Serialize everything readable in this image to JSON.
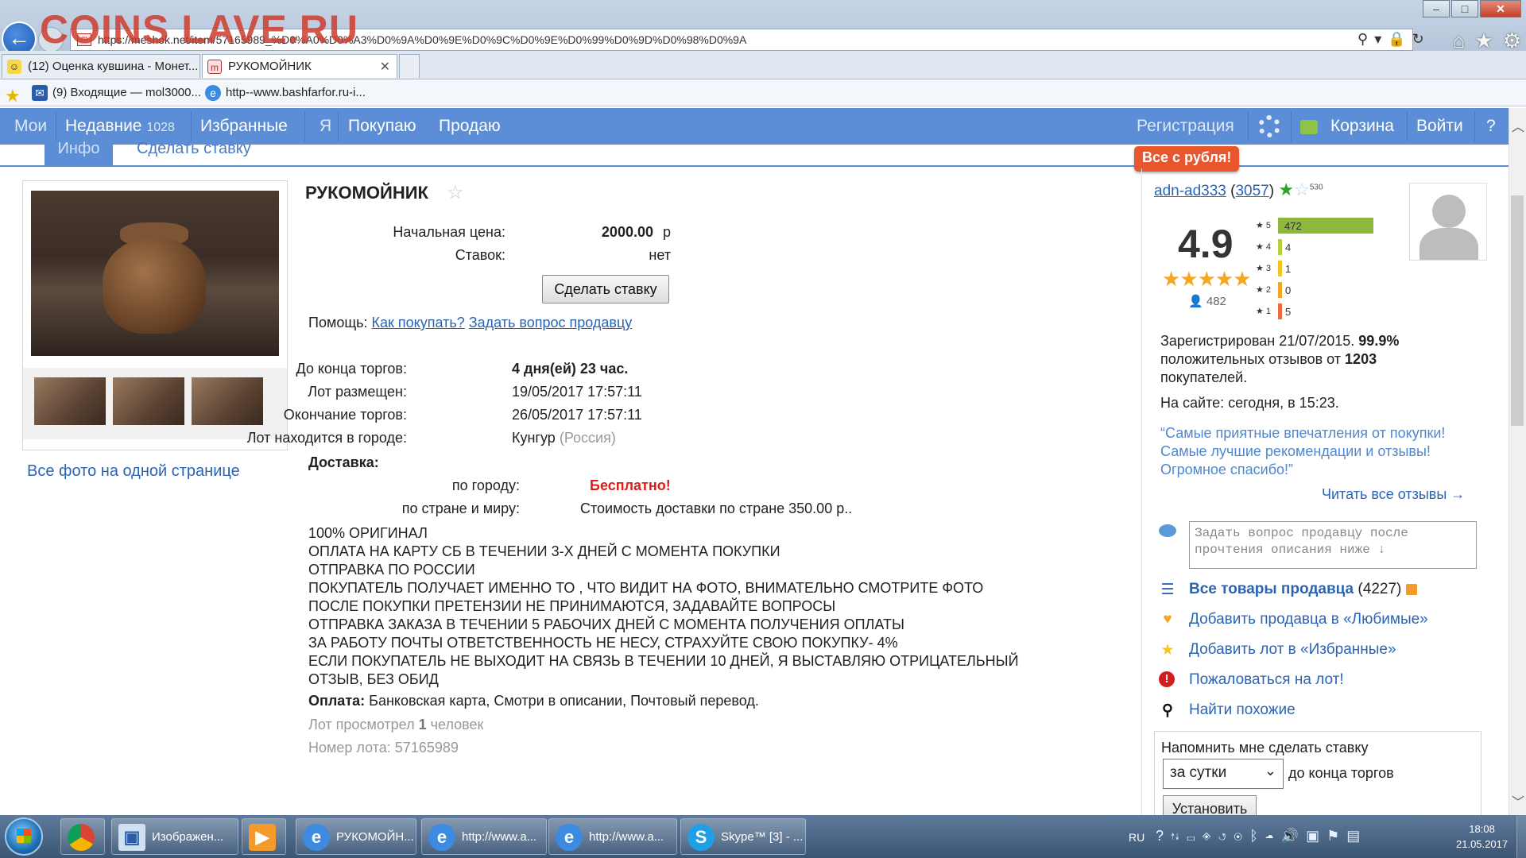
{
  "watermark": "COINS LAVE.RU",
  "browser": {
    "url": "https://meshok.net/item/57165989_%D0%A0%D0%A3%D0%9A%D0%9E%D0%9C%D0%9E%D0%99%D0%9D%D0%98%D0%9A",
    "tabs": [
      {
        "label": "(12) Оценка кувшина - Монет...",
        "active": false
      },
      {
        "label": "РУКОМОЙНИК",
        "active": true
      }
    ],
    "favorites": [
      {
        "label": "(9) Входящие — mol3000..."
      },
      {
        "label": "http--www.bashfarfor.ru-i..."
      }
    ]
  },
  "sitenav": {
    "left": [
      {
        "label": "Мои"
      },
      {
        "label": "Недавние",
        "count": "1028"
      },
      {
        "label": "Избранные"
      },
      {
        "label": "Я"
      },
      {
        "label": "Покупаю"
      },
      {
        "label": "Продаю"
      }
    ],
    "register": "Регистрация",
    "cart": "Корзина",
    "login": "Войти",
    "help": "?"
  },
  "subtabs": {
    "info": "Инфо",
    "bid": "Сделать ставку"
  },
  "promo_badge": "Все с рубля!",
  "gallery": {
    "all_photos_link": "Все фото на одной странице"
  },
  "lot": {
    "title": "РУКОМОЙНИК",
    "start_price_label": "Начальная цена:",
    "start_price": "2000.00",
    "currency": "р",
    "bids_label": "Ставок:",
    "bids": "нет",
    "bid_button": "Сделать ставку",
    "help_label": "Помощь:",
    "help_how": "Как покупать?",
    "help_ask": "Задать вопрос продавцу",
    "ends_in_label": "До конца торгов:",
    "ends_in": "4 дня(ей) 23 час.",
    "placed_label": "Лот размещен:",
    "placed": "19/05/2017 17:57:11",
    "end_label": "Окончание торгов:",
    "end": "26/05/2017 17:57:11",
    "city_label": "Лот находится в городе:",
    "city": "Кунгур",
    "country": "(Россия)",
    "delivery_label": "Доставка:",
    "delivery_city_label": "по городу:",
    "delivery_city": "Бесплатно!",
    "delivery_world_label": "по стране и миру:",
    "delivery_world": "Стоимость доставки по стране 350.00 р..",
    "description": [
      "100% ОРИГИНАЛ",
      "ОПЛАТА НА КАРТУ СБ В ТЕЧЕНИИ 3-Х ДНЕЙ С МОМЕНТА ПОКУПКИ",
      "ОТПРАВКА ПО РОССИИ",
      "ПОКУПАТЕЛЬ ПОЛУЧАЕТ ИМЕННО ТО , ЧТО ВИДИТ НА ФОТО, ВНИМАТЕЛЬНО СМОТРИТЕ ФОТО",
      "ПОСЛЕ ПОКУПКИ ПРЕТЕНЗИИ НЕ ПРИНИМАЮТСЯ, ЗАДАВАЙТЕ ВОПРОСЫ",
      "ОТПРАВКА ЗАКАЗА В ТЕЧЕНИИ 5 РАБОЧИХ ДНЕЙ С МОМЕНТА ПОЛУЧЕНИЯ ОПЛАТЫ",
      "ЗА РАБОТУ ПОЧТЫ ОТВЕТСТВЕННОСТЬ НЕ НЕСУ, СТРАХУЙТЕ СВОЮ ПОКУПКУ- 4%",
      "ЕСЛИ ПОКУПАТЕЛЬ НЕ ВЫХОДИТ НА СВЯЗЬ В ТЕЧЕНИИ 10 ДНЕЙ, Я ВЫСТАВЛЯЮ ОТРИЦАТЕЛЬНЫЙ",
      "ОТЗЫВ, БЕЗ ОБИД"
    ],
    "payment_label": "Оплата:",
    "payment": "Банковская карта, Смотри в описании, Почтовый перевод.",
    "views_prefix": "Лот просмотрел",
    "views": "1",
    "views_suffix": "человек",
    "lot_number_label": "Номер лота:",
    "lot_number": "57165989"
  },
  "seller": {
    "name": "adn-ad333",
    "feedback_count": "3057",
    "small_count": "530",
    "rating": "4.9",
    "votes": "482",
    "histogram": [
      {
        "stars": "5",
        "count": "472",
        "value": 472,
        "color": "#8db83c"
      },
      {
        "stars": "4",
        "count": "4",
        "value": 4,
        "color": "#b7cf3a"
      },
      {
        "stars": "3",
        "count": "1",
        "value": 1,
        "color": "#f2c61e"
      },
      {
        "stars": "2",
        "count": "0",
        "value": 0,
        "color": "#f5a623"
      },
      {
        "stars": "1",
        "count": "5",
        "value": 5,
        "color": "#ef6a3a"
      }
    ],
    "registered_label": "Зарегистрирован",
    "registered": "21/07/2015.",
    "positive_pct": "99.9%",
    "positive_text": "положительных отзывов от",
    "buyers": "1203",
    "buyers_word": "покупателей.",
    "online": "На сайте: сегодня, в 15:23.",
    "quote": [
      "“Самые приятные впечатления от покупки!",
      "Самые лучшие рекомендации и отзывы!",
      "Огромное спасибо!”"
    ],
    "read_all": "Читать все отзывы →",
    "ask_placeholder": "Задать вопрос продавцу после прочтения описания ниже ↓",
    "all_items": "Все товары продавца",
    "all_items_count": "(4227)",
    "add_favorite_seller": "Добавить продавца в «Любимые»",
    "add_favorite_lot": "Добавить лот в «Избранные»",
    "complain": "Пожаловаться на лот!",
    "find_similar": "Найти похожие"
  },
  "reminder": {
    "title": "Напомнить мне сделать ставку",
    "selected": "за сутки",
    "tail": "до конца торгов",
    "button": "Установить"
  },
  "taskbar": {
    "items": [
      {
        "label": "Изображен..."
      },
      {
        "label": "РУКОМОЙН..."
      },
      {
        "label": "http://www.a..."
      },
      {
        "label": "http://www.a..."
      },
      {
        "label": "Skype™ [3] - ..."
      }
    ],
    "lang": "RU",
    "time": "18:08",
    "date": "21.05.2017"
  }
}
